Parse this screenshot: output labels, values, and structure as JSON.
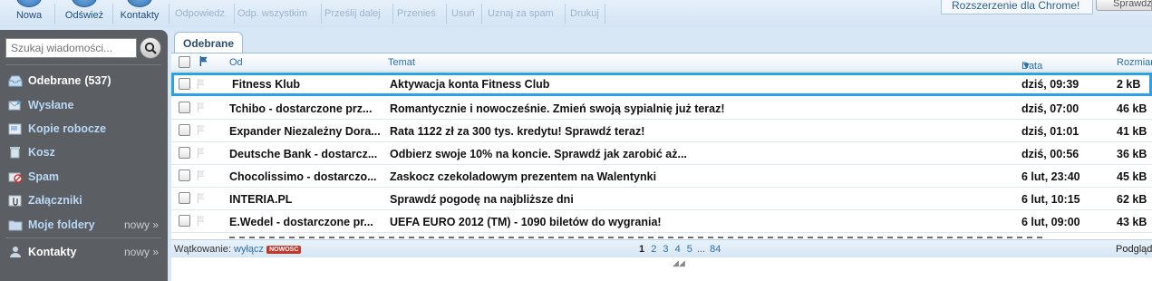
{
  "toolbar": {
    "new_label": "Nowa",
    "refresh_label": "Odśwież",
    "contacts_label": "Kontakty",
    "reply_label": "Odpowiedz",
    "reply_all_label": "Odp. wszystkim",
    "forward_label": "Prześlij dalej",
    "move_label": "Przenieś",
    "delete_label": "Usuń",
    "spam_label": "Uznaj za spam",
    "print_label": "Drukuj",
    "chrome_ext_label": "Rozszerzenie dla Chrome!",
    "side_button_label": "Sprawdź"
  },
  "sidebar": {
    "search_placeholder": "Szukaj wiadomości...",
    "items": [
      {
        "label": "Odebrane",
        "count": "(537)"
      },
      {
        "label": "Wysłane"
      },
      {
        "label": "Kopie robocze"
      },
      {
        "label": "Kosz"
      },
      {
        "label": "Spam"
      },
      {
        "label": "Załączniki"
      },
      {
        "label": "Moje foldery",
        "extra": "nowy »"
      },
      {
        "label": "Kontakty",
        "extra": "nowy »"
      }
    ]
  },
  "tab": {
    "label": "Odebrane"
  },
  "columns": {
    "from": "Od",
    "subject": "Temat",
    "date": "Data",
    "size": "Rozmiar"
  },
  "messages": [
    {
      "from": "Fitness Klub",
      "subject": "Aktywacja konta Fitness Club",
      "date": "dziś, 09:39",
      "size": "2 kB"
    },
    {
      "from": "Tchibo - dostarczone prz...",
      "subject": "Romantycznie i nowocześnie. Zmień swoją sypialnię już teraz!",
      "date": "dziś, 07:00",
      "size": "46 kB"
    },
    {
      "from": "Expander Niezależny Dora...",
      "subject": "Rata 1122 zł za 300 tys. kredytu! Sprawdź teraz!",
      "date": "dziś, 01:01",
      "size": "41 kB"
    },
    {
      "from": "Deutsche Bank - dostarcz...",
      "subject": "Odbierz swoje 10% na koncie. Sprawdź jak zarobić aż...",
      "date": "dziś, 00:56",
      "size": "36 kB"
    },
    {
      "from": "Chocolissimo - dostarczo...",
      "subject": "Zaskocz czekoladowym prezentem na Walentynki",
      "date": "6 lut, 23:40",
      "size": "45 kB"
    },
    {
      "from": "INTERIA.PL",
      "subject": "Sprawdź pogodę na najbliższe dni",
      "date": "6 lut, 10:15",
      "size": "62 kB"
    },
    {
      "from": "E.Wedel - dostarczone pr...",
      "subject": "UEFA EURO 2012 (TM) - 1090 biletów do wygrania!",
      "date": "6 lut, 09:00",
      "size": "43 kB"
    }
  ],
  "footer": {
    "threading_label": "Wątkowanie:",
    "threading_link": "wyłącz",
    "new_badge": "NOWOŚĆ",
    "pages": [
      "1",
      "2",
      "3",
      "4",
      "5"
    ],
    "ellipsis": "...",
    "last_page": "84",
    "preview_label": "Podgląd"
  }
}
